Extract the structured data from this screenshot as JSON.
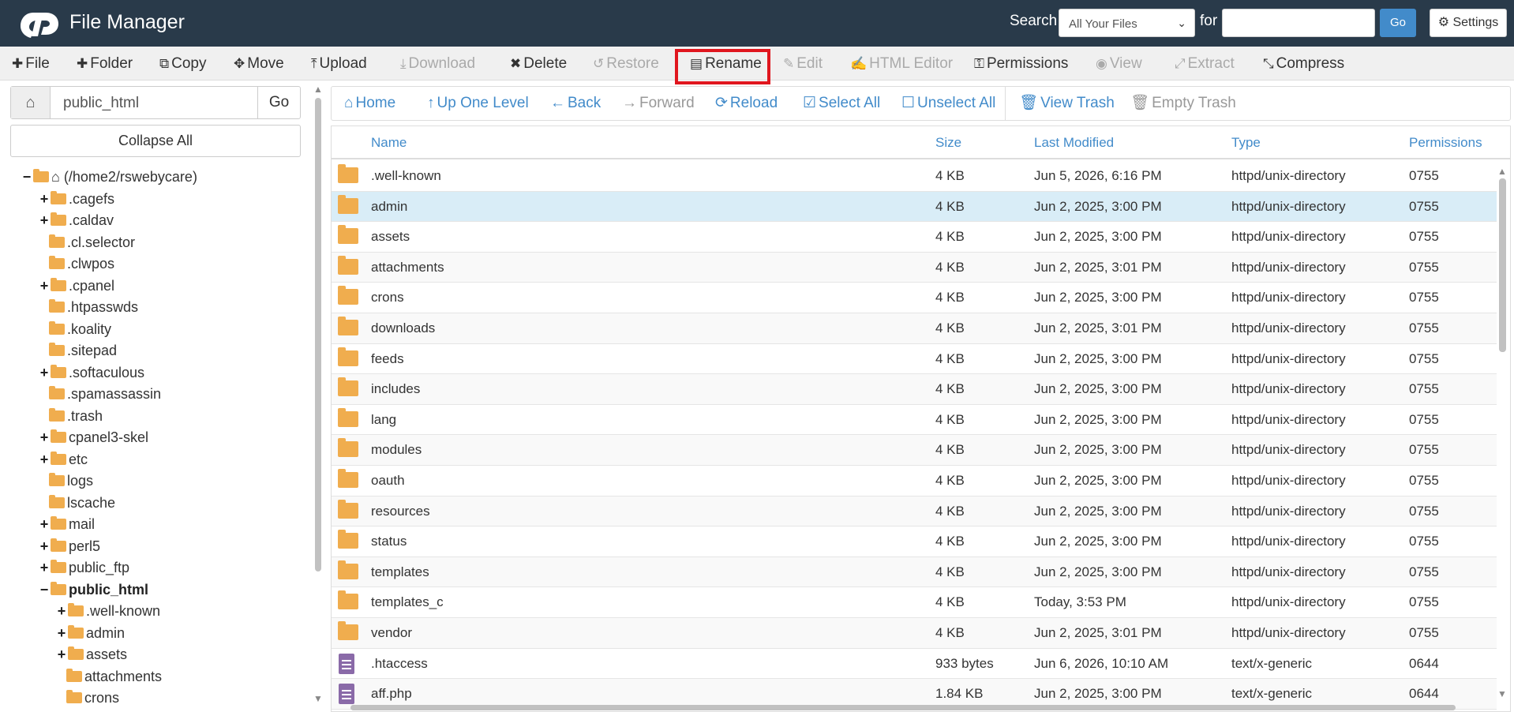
{
  "header": {
    "title": "File Manager",
    "search_label": "Search",
    "search_scope": "All Your Files",
    "for_label": "for",
    "search_value": "",
    "go_label": "Go",
    "settings_label": "Settings"
  },
  "toolbar": {
    "file": "File",
    "folder": "Folder",
    "copy": "Copy",
    "move": "Move",
    "upload": "Upload",
    "download": "Download",
    "delete": "Delete",
    "restore": "Restore",
    "rename": "Rename",
    "edit": "Edit",
    "html_editor": "HTML Editor",
    "permissions": "Permissions",
    "view": "View",
    "extract": "Extract",
    "compress": "Compress"
  },
  "sidebar": {
    "path_value": "public_html",
    "go_label": "Go",
    "collapse_label": "Collapse All",
    "tree": [
      {
        "label": "(/home2/rswebycare)",
        "toggle": "−"
      },
      {
        "label": ".cagefs",
        "toggle": "+"
      },
      {
        "label": ".caldav",
        "toggle": "+"
      },
      {
        "label": ".cl.selector",
        "toggle": ""
      },
      {
        "label": ".clwpos",
        "toggle": ""
      },
      {
        "label": ".cpanel",
        "toggle": "+"
      },
      {
        "label": ".htpasswds",
        "toggle": ""
      },
      {
        "label": ".koality",
        "toggle": ""
      },
      {
        "label": ".sitepad",
        "toggle": ""
      },
      {
        "label": ".softaculous",
        "toggle": "+"
      },
      {
        "label": ".spamassassin",
        "toggle": ""
      },
      {
        "label": ".trash",
        "toggle": ""
      },
      {
        "label": "cpanel3-skel",
        "toggle": "+"
      },
      {
        "label": "etc",
        "toggle": "+"
      },
      {
        "label": "logs",
        "toggle": ""
      },
      {
        "label": "lscache",
        "toggle": ""
      },
      {
        "label": "mail",
        "toggle": "+"
      },
      {
        "label": "perl5",
        "toggle": "+"
      },
      {
        "label": "public_ftp",
        "toggle": "+"
      },
      {
        "label": "public_html",
        "toggle": "−"
      },
      {
        "label": ".well-known",
        "toggle": "+"
      },
      {
        "label": "admin",
        "toggle": "+"
      },
      {
        "label": "assets",
        "toggle": "+"
      },
      {
        "label": "attachments",
        "toggle": ""
      },
      {
        "label": "crons",
        "toggle": ""
      }
    ]
  },
  "nav": {
    "home": "Home",
    "up_one_level": "Up One Level",
    "back": "Back",
    "forward": "Forward",
    "reload": "Reload",
    "select_all": "Select All",
    "unselect_all": "Unselect All",
    "view_trash": "View Trash",
    "empty_trash": "Empty Trash"
  },
  "table": {
    "columns": [
      "Name",
      "Size",
      "Last Modified",
      "Type",
      "Permissions"
    ],
    "rows": [
      {
        "name": ".well-known",
        "size": "4 KB",
        "modified": "Jun 5, 2026, 6:16 PM",
        "type": "httpd/unix-directory",
        "perms": "0755",
        "kind": "folder"
      },
      {
        "name": "admin",
        "size": "4 KB",
        "modified": "Jun 2, 2025, 3:00 PM",
        "type": "httpd/unix-directory",
        "perms": "0755",
        "kind": "folder",
        "selected": true
      },
      {
        "name": "assets",
        "size": "4 KB",
        "modified": "Jun 2, 2025, 3:00 PM",
        "type": "httpd/unix-directory",
        "perms": "0755",
        "kind": "folder"
      },
      {
        "name": "attachments",
        "size": "4 KB",
        "modified": "Jun 2, 2025, 3:01 PM",
        "type": "httpd/unix-directory",
        "perms": "0755",
        "kind": "folder"
      },
      {
        "name": "crons",
        "size": "4 KB",
        "modified": "Jun 2, 2025, 3:00 PM",
        "type": "httpd/unix-directory",
        "perms": "0755",
        "kind": "folder"
      },
      {
        "name": "downloads",
        "size": "4 KB",
        "modified": "Jun 2, 2025, 3:01 PM",
        "type": "httpd/unix-directory",
        "perms": "0755",
        "kind": "folder"
      },
      {
        "name": "feeds",
        "size": "4 KB",
        "modified": "Jun 2, 2025, 3:00 PM",
        "type": "httpd/unix-directory",
        "perms": "0755",
        "kind": "folder"
      },
      {
        "name": "includes",
        "size": "4 KB",
        "modified": "Jun 2, 2025, 3:00 PM",
        "type": "httpd/unix-directory",
        "perms": "0755",
        "kind": "folder"
      },
      {
        "name": "lang",
        "size": "4 KB",
        "modified": "Jun 2, 2025, 3:00 PM",
        "type": "httpd/unix-directory",
        "perms": "0755",
        "kind": "folder"
      },
      {
        "name": "modules",
        "size": "4 KB",
        "modified": "Jun 2, 2025, 3:00 PM",
        "type": "httpd/unix-directory",
        "perms": "0755",
        "kind": "folder"
      },
      {
        "name": "oauth",
        "size": "4 KB",
        "modified": "Jun 2, 2025, 3:00 PM",
        "type": "httpd/unix-directory",
        "perms": "0755",
        "kind": "folder"
      },
      {
        "name": "resources",
        "size": "4 KB",
        "modified": "Jun 2, 2025, 3:00 PM",
        "type": "httpd/unix-directory",
        "perms": "0755",
        "kind": "folder"
      },
      {
        "name": "status",
        "size": "4 KB",
        "modified": "Jun 2, 2025, 3:00 PM",
        "type": "httpd/unix-directory",
        "perms": "0755",
        "kind": "folder"
      },
      {
        "name": "templates",
        "size": "4 KB",
        "modified": "Jun 2, 2025, 3:00 PM",
        "type": "httpd/unix-directory",
        "perms": "0755",
        "kind": "folder"
      },
      {
        "name": "templates_c",
        "size": "4 KB",
        "modified": "Today, 3:53 PM",
        "type": "httpd/unix-directory",
        "perms": "0755",
        "kind": "folder"
      },
      {
        "name": "vendor",
        "size": "4 KB",
        "modified": "Jun 2, 2025, 3:01 PM",
        "type": "httpd/unix-directory",
        "perms": "0755",
        "kind": "folder"
      },
      {
        "name": ".htaccess",
        "size": "933 bytes",
        "modified": "Jun 6, 2026, 10:10 AM",
        "type": "text/x-generic",
        "perms": "0644",
        "kind": "file"
      },
      {
        "name": "aff.php",
        "size": "1.84 KB",
        "modified": "Jun 2, 2025, 3:00 PM",
        "type": "text/x-generic",
        "perms": "0644",
        "kind": "file"
      }
    ]
  },
  "colors": {
    "header_bg": "#293a4a",
    "accent": "#428bca",
    "folder": "#f0ad4e",
    "highlight": "#e0161e",
    "selected_row": "#d9edf7"
  }
}
